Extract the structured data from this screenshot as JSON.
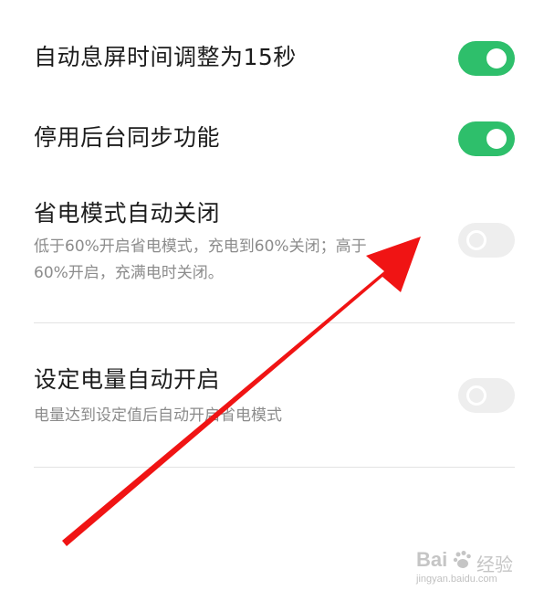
{
  "settings": [
    {
      "title": "自动息屏时间调整为15秒",
      "desc": "",
      "toggle": "on"
    },
    {
      "title": "停用后台同步功能",
      "desc": "",
      "toggle": "on"
    },
    {
      "title": "省电模式自动关闭",
      "desc_line1": "低于60%开启省电模式，充电到60%关闭；高于",
      "desc_line2": "60%开启，充满电时关闭。",
      "toggle": "off"
    },
    {
      "title": "设定电量自动开启",
      "desc": "电量达到设定值后自动开启省电模式",
      "toggle": "off"
    }
  ],
  "annotation": {
    "type": "red-arrow",
    "color": "#f01414"
  },
  "watermark": {
    "brand": "Bai",
    "cn": "经验",
    "url": "jingyan.baidu.com"
  },
  "colors": {
    "toggle_on": "#2ebf6b",
    "toggle_off": "#eeeeee",
    "arrow": "#f01414"
  }
}
